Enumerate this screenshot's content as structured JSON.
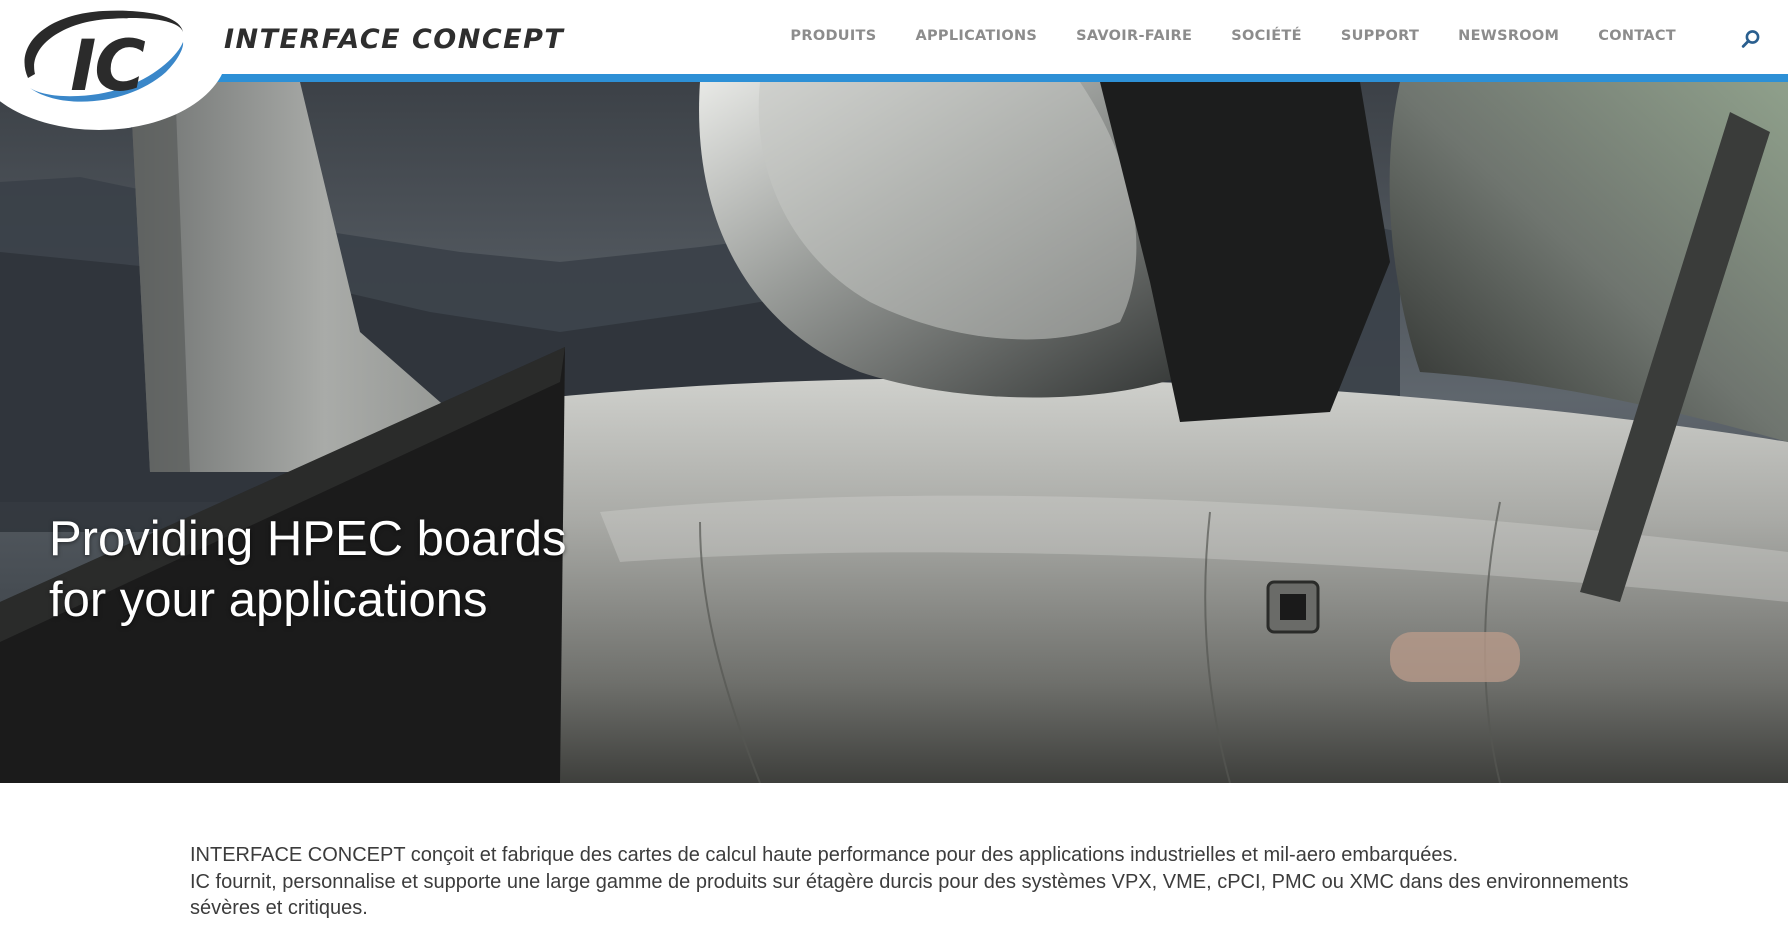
{
  "brand": {
    "logo_mark": "IC",
    "name": "INTERFACE CONCEPT"
  },
  "nav": {
    "items": [
      {
        "label": "PRODUITS",
        "id": "produits"
      },
      {
        "label": "APPLICATIONS",
        "id": "applications"
      },
      {
        "label": "SAVOIR-FAIRE",
        "id": "savoir-faire"
      },
      {
        "label": "SOCIÉTÉ",
        "id": "societe"
      },
      {
        "label": "SUPPORT",
        "id": "support"
      },
      {
        "label": "NEWSROOM",
        "id": "newsroom"
      },
      {
        "label": "CONTACT",
        "id": "contact"
      }
    ],
    "search_icon": "search-icon"
  },
  "hero": {
    "headline_line1": "Providing HPEC boards",
    "headline_line2": "for your applications",
    "image": "fighter-jet-cockpit-photo"
  },
  "intro": {
    "line1": "INTERFACE CONCEPT conçoit et fabrique des cartes de calcul haute performance pour des applications industrielles et mil-aero embarquées.",
    "line2": "IC fournit, personnalise et supporte une large gamme de produits sur étagère durcis pour des systèmes VPX, VME, cPCI, PMC ou XMC dans des environnements",
    "line3": "sévères et critiques."
  },
  "colors": {
    "accent": "#2d90d6",
    "nav_text": "#8c8c8c",
    "logo_text": "#2e2e2e",
    "body_text": "#3c3c3c"
  }
}
